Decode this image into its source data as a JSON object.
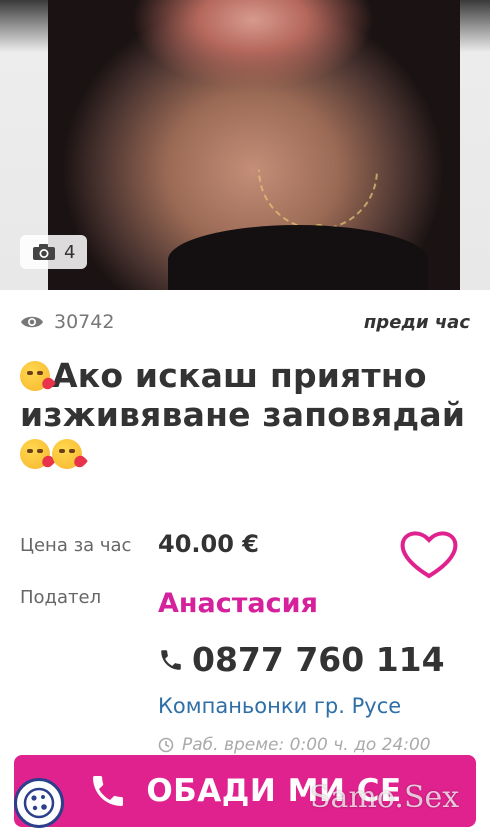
{
  "gallery": {
    "photo_count": "4"
  },
  "meta": {
    "views": "30742",
    "posted": "преди час"
  },
  "listing": {
    "title_part1": "Ако искаш приятно изживяване заповядай",
    "price_label": "Цена за час",
    "price_value": "40.00 €",
    "owner_label": "Подател",
    "owner_name": "Анастасия",
    "phone": "0877 760 114",
    "category_link": "Компаньонки гр. Русе",
    "hours": "Раб. време: 0:00 ч. до 24:00"
  },
  "cta": {
    "call_label": "ОБАДИ МИ СЕ"
  },
  "watermark": "Samo.Sex",
  "colors": {
    "accent": "#e0228f",
    "owner_name": "#d5219b",
    "link": "#2f6fa8"
  },
  "icons": [
    "camera-icon",
    "eye-icon",
    "kiss-emoji-icon",
    "heart-icon",
    "phone-icon",
    "clock-icon",
    "cookie-icon"
  ]
}
